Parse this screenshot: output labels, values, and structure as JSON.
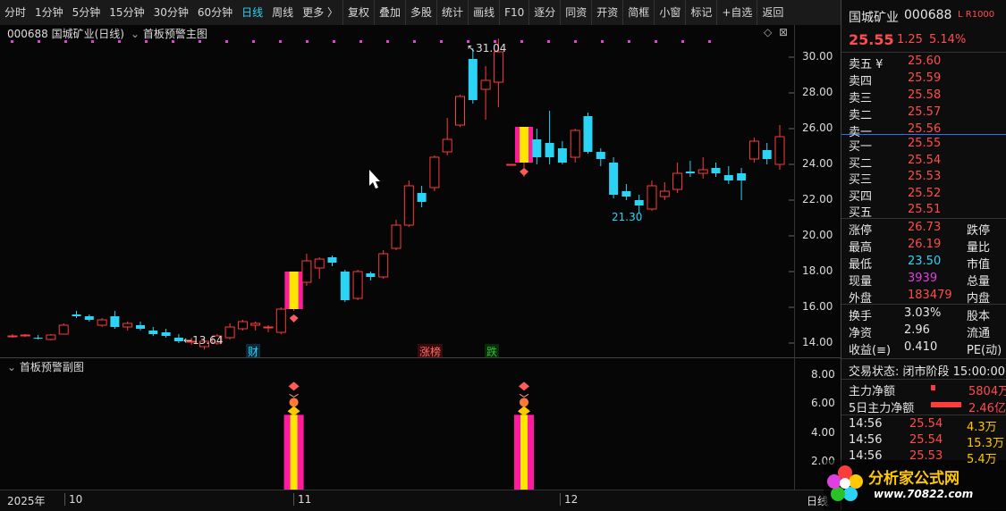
{
  "toolbar": {
    "items": [
      "分时",
      "1分钟",
      "5分钟",
      "15分钟",
      "30分钟",
      "60分钟",
      "日线",
      "周线",
      "更多 〉",
      "复权",
      "叠加",
      "多股",
      "统计",
      "画线",
      "F10",
      "逐分",
      "同资",
      "开资",
      "简框",
      "小窗",
      "标记",
      "+自选",
      "返回"
    ],
    "active": "日线"
  },
  "chart_header": {
    "code_name": "000688  国城矿业(日线)",
    "indicator_main": "首板预警主图",
    "indicator_sub": "首板预警副图"
  },
  "annotations": {
    "high": "31.04",
    "low": "13.64",
    "local_low": "21.30",
    "tag_cai": "财",
    "tag_zhangbang": "涨榜",
    "tag_die": "跌"
  },
  "chart_data": [
    {
      "type": "candlestick",
      "title": "000688 国城矿业(日线)",
      "ylim": [
        13.2,
        31.6
      ],
      "y_ticks": [
        "14.00",
        "16.00",
        "18.00",
        "20.00",
        "22.00",
        "24.00",
        "26.00",
        "28.00",
        "30.00"
      ],
      "x_labels": [
        "2025年",
        "10",
        "11",
        "12"
      ],
      "ohlc": [
        [
          14.4,
          14.5,
          14.3,
          14.4
        ],
        [
          14.4,
          14.5,
          14.35,
          14.45
        ],
        [
          14.3,
          14.45,
          14.2,
          14.25
        ],
        [
          14.2,
          14.5,
          14.15,
          14.45
        ],
        [
          14.5,
          15.1,
          14.5,
          15.0
        ],
        [
          15.6,
          15.8,
          15.4,
          15.5
        ],
        [
          15.5,
          15.6,
          15.2,
          15.3
        ],
        [
          15.0,
          15.4,
          14.9,
          15.3
        ],
        [
          15.5,
          15.8,
          14.8,
          14.9
        ],
        [
          14.9,
          15.2,
          14.7,
          15.1
        ],
        [
          15.0,
          15.2,
          14.7,
          14.8
        ],
        [
          14.7,
          14.9,
          14.4,
          14.5
        ],
        [
          14.6,
          14.8,
          14.3,
          14.4
        ],
        [
          14.3,
          14.5,
          14.0,
          14.1
        ],
        [
          14.1,
          14.3,
          13.9,
          14.1
        ],
        [
          13.8,
          14.2,
          13.64,
          14.1
        ],
        [
          14.0,
          14.5,
          13.9,
          14.4
        ],
        [
          14.3,
          15.1,
          14.2,
          14.9
        ],
        [
          14.8,
          15.3,
          14.7,
          15.2
        ],
        [
          15.0,
          15.2,
          14.7,
          15.1
        ],
        [
          14.9,
          15.0,
          14.6,
          14.9
        ],
        [
          14.6,
          16.0,
          14.5,
          15.9
        ],
        [
          15.9,
          17.4,
          15.8,
          17.3
        ],
        [
          17.4,
          19.0,
          17.2,
          18.6
        ],
        [
          18.2,
          18.8,
          17.6,
          18.7
        ],
        [
          18.8,
          18.9,
          18.3,
          18.5
        ],
        [
          18.0,
          18.1,
          16.3,
          16.4
        ],
        [
          16.5,
          18.1,
          16.4,
          18.0
        ],
        [
          17.9,
          18.0,
          17.5,
          17.7
        ],
        [
          17.7,
          19.2,
          17.6,
          19.0
        ],
        [
          19.3,
          20.9,
          19.2,
          20.6
        ],
        [
          20.6,
          23.1,
          20.5,
          22.8
        ],
        [
          22.4,
          22.8,
          21.6,
          21.9
        ],
        [
          22.7,
          24.5,
          22.5,
          24.4
        ],
        [
          24.7,
          26.6,
          24.5,
          25.4
        ],
        [
          26.2,
          27.9,
          26.1,
          27.8
        ],
        [
          29.9,
          30.5,
          27.4,
          27.6
        ],
        [
          28.2,
          29.5,
          26.5,
          28.7
        ],
        [
          28.6,
          31.04,
          27.2,
          30.3
        ],
        [
          24.0,
          24.0,
          24.0,
          24.0
        ],
        [
          24.1,
          25.9,
          23.3,
          25.4
        ],
        [
          25.4,
          26.0,
          24.0,
          24.4
        ],
        [
          25.2,
          27.0,
          24.0,
          24.4
        ],
        [
          24.9,
          25.3,
          24.0,
          24.1
        ],
        [
          24.4,
          26.0,
          24.1,
          25.9
        ],
        [
          26.7,
          26.9,
          24.6,
          24.7
        ],
        [
          24.7,
          24.9,
          23.9,
          24.3
        ],
        [
          24.1,
          24.4,
          22.1,
          22.3
        ],
        [
          22.5,
          22.9,
          22.0,
          22.2
        ],
        [
          22.0,
          22.3,
          21.3,
          21.7
        ],
        [
          21.5,
          23.1,
          21.4,
          22.8
        ],
        [
          22.2,
          23.0,
          22.0,
          22.5
        ],
        [
          22.6,
          24.1,
          22.4,
          23.5
        ],
        [
          23.6,
          24.2,
          23.3,
          23.5
        ],
        [
          23.5,
          24.4,
          23.2,
          23.7
        ],
        [
          23.8,
          24.1,
          23.3,
          23.5
        ],
        [
          23.4,
          23.9,
          22.9,
          23.1
        ],
        [
          23.5,
          23.8,
          22.0,
          23.1
        ],
        [
          24.3,
          25.5,
          24.1,
          25.3
        ],
        [
          24.8,
          25.2,
          24.0,
          24.3
        ],
        [
          24.0,
          26.2,
          23.7,
          25.55
        ]
      ],
      "signal_days": [
        22,
        40
      ]
    },
    {
      "type": "bar",
      "title": "首板预警副图",
      "ylim": [
        0,
        9.2
      ],
      "y_ticks": [
        "2.00",
        "4.00",
        "6.00",
        "8.00"
      ],
      "values": [
        5.2,
        5.2
      ],
      "positions": [
        22,
        40
      ]
    }
  ],
  "quote": {
    "name": "国城矿业",
    "code": "000688",
    "tag": "L R",
    "tag2": "1000",
    "price": "25.55",
    "change": "1.25",
    "change_pct": "5.14%",
    "asks": [
      {
        "label": "卖五 ¥",
        "price": "25.60"
      },
      {
        "label": "卖四",
        "price": "25.59"
      },
      {
        "label": "卖三",
        "price": "25.58"
      },
      {
        "label": "卖二",
        "price": "25.57"
      },
      {
        "label": "卖一",
        "price": "25.56"
      }
    ],
    "bids": [
      {
        "label": "买一",
        "price": "25.55"
      },
      {
        "label": "买二",
        "price": "25.54"
      },
      {
        "label": "买三",
        "price": "25.53"
      },
      {
        "label": "买四",
        "price": "25.52"
      },
      {
        "label": "买五",
        "price": "25.51"
      }
    ],
    "stats": [
      {
        "l": "涨停",
        "v": "26.73",
        "r": "跌停"
      },
      {
        "l": "最高",
        "v": "26.19",
        "r": "量比"
      },
      {
        "l": "最低",
        "v": "23.50",
        "r": "市值"
      },
      {
        "l": "现量",
        "v": "3939",
        "r": "总量"
      },
      {
        "l": "外盘",
        "v": "183479",
        "r": "内盘"
      }
    ],
    "stats2": [
      {
        "l": "换手",
        "v": "3.03%",
        "r": "股本"
      },
      {
        "l": "净资",
        "v": "2.96",
        "r": "流通"
      },
      {
        "l": "收益(≡)",
        "v": "0.410",
        "r": "PE(动)"
      }
    ],
    "trade_status": "交易状态: 闭市阶段 15:00:00",
    "flow": [
      {
        "l": "主力净额",
        "v": "5804万"
      },
      {
        "l": "5日主力净额",
        "v": "2.46亿"
      }
    ],
    "ticks": [
      {
        "t": "14:56",
        "p": "25.54",
        "q": "4.3万"
      },
      {
        "t": "14:56",
        "p": "25.54",
        "q": "15.3万"
      },
      {
        "t": "14:56",
        "p": "25.53",
        "q": "5.4万"
      }
    ],
    "time_axis_right": "日线"
  },
  "watermark": {
    "text": "分析家公式网",
    "url": "www.70822.com"
  }
}
